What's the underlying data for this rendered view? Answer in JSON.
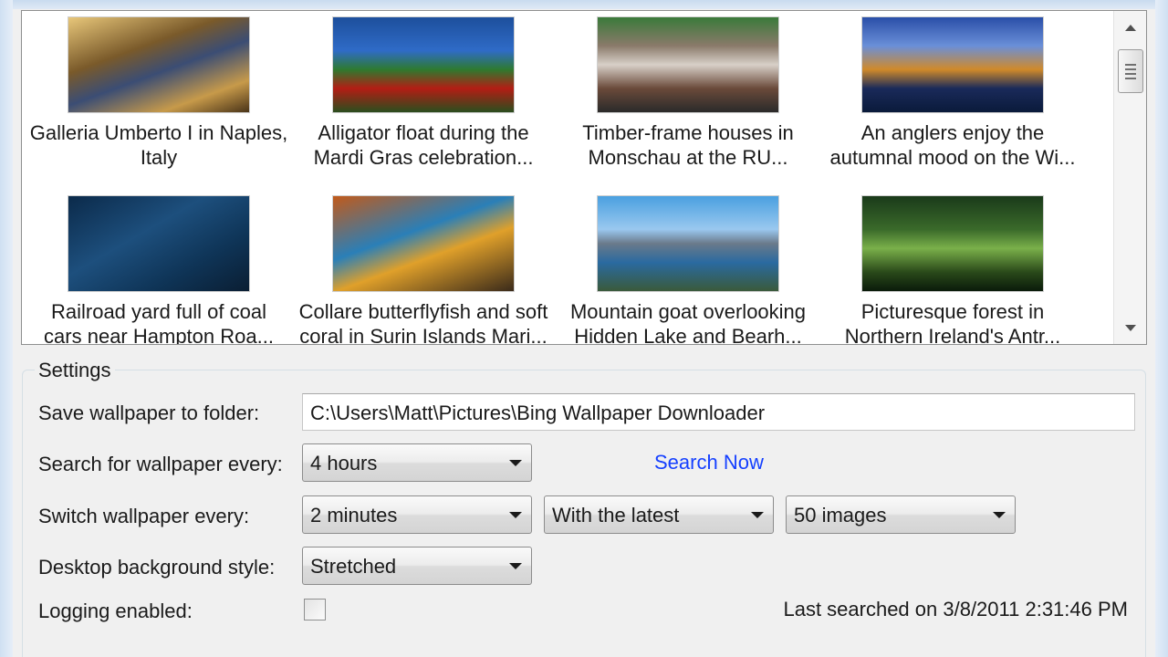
{
  "gallery": {
    "items": [
      {
        "line1": "Galleria Umberto I in Naples,",
        "line2": "Italy",
        "thumb": "linear-gradient(160deg,#e8c77a 0%,#7a5a2a 35%,#3b4d74 55%,#c79a4a 80%,#4a3418 100%)"
      },
      {
        "line1": "Alligator float during the",
        "line2": "Mardi Gras celebration...",
        "thumb": "linear-gradient(180deg,#1d4f9c 0%,#2f6bc7 35%,#2e7a2f 55%,#b31d14 75%,#2a4e1e 100%)"
      },
      {
        "line1": "Timber-frame houses in",
        "line2": "Monschau at the RU...",
        "thumb": "linear-gradient(180deg,#3a7a3a 0%,#8a7a6a 30%,#d8d0c8 50%,#6a4a3a 75%,#2a2a2a 100%)"
      },
      {
        "line1": "An anglers enjoy the",
        "line2": "autumnal mood on the Wi...",
        "thumb": "linear-gradient(180deg,#2a4fa8 0%,#6a8fd8 30%,#d08a2a 55%,#1a2a5a 75%,#0a1a3a 100%)"
      },
      {
        "line1": "Railroad yard full of coal",
        "line2": "cars near Hampton Roa...",
        "thumb": "linear-gradient(150deg,#0b2a4a 0%,#1d4f7d 40%,#0f3558 70%,#0a1e33 100%)"
      },
      {
        "line1": "Collare butterflyfish and soft",
        "line2": "coral in Surin Islands Mari...",
        "thumb": "linear-gradient(160deg,#c25a1a 0%,#2a7fb8 40%,#e0a02a 60%,#3a2a1a 100%)"
      },
      {
        "line1": "Mountain goat overlooking",
        "line2": "Hidden Lake and Bearh...",
        "thumb": "linear-gradient(180deg,#4aa0e0 0%,#9ac8ef 35%,#6a7a8a 50%,#2a6aa0 70%,#3a5a3a 100%)"
      },
      {
        "line1": "Picturesque forest in",
        "line2": "Northern Ireland's Antr...",
        "thumb": "linear-gradient(180deg,#1a3a1a 0%,#3a6a2a 35%,#7ab04a 55%,#2a4a1a 80%,#0a1a0a 100%)"
      }
    ]
  },
  "icons": {
    "scroll_up": "scroll-up-arrow-icon",
    "scroll_down": "scroll-down-arrow-icon",
    "scroll_grip": "scroll-grip-icon",
    "dropdown": "chevron-down-icon"
  },
  "settings": {
    "legend": "Settings",
    "save_folder_label": "Save wallpaper to folder:",
    "save_folder_value": "C:\\Users\\Matt\\Pictures\\Bing Wallpaper Downloader",
    "search_every_label": "Search for wallpaper every:",
    "search_every_value": "4 hours",
    "search_now": "Search Now",
    "switch_every_label": "Switch wallpaper every:",
    "switch_every_value": "2 minutes",
    "switch_mode_value": "With the latest",
    "switch_count_value": "50 images",
    "bg_style_label": "Desktop background style:",
    "bg_style_value": "Stretched",
    "logging_label": "Logging enabled:",
    "logging_checked": false,
    "last_searched": "Last searched on 3/8/2011 2:31:46 PM"
  },
  "colors": {
    "link": "#1540ff",
    "window_bg": "#f0f0f0"
  }
}
